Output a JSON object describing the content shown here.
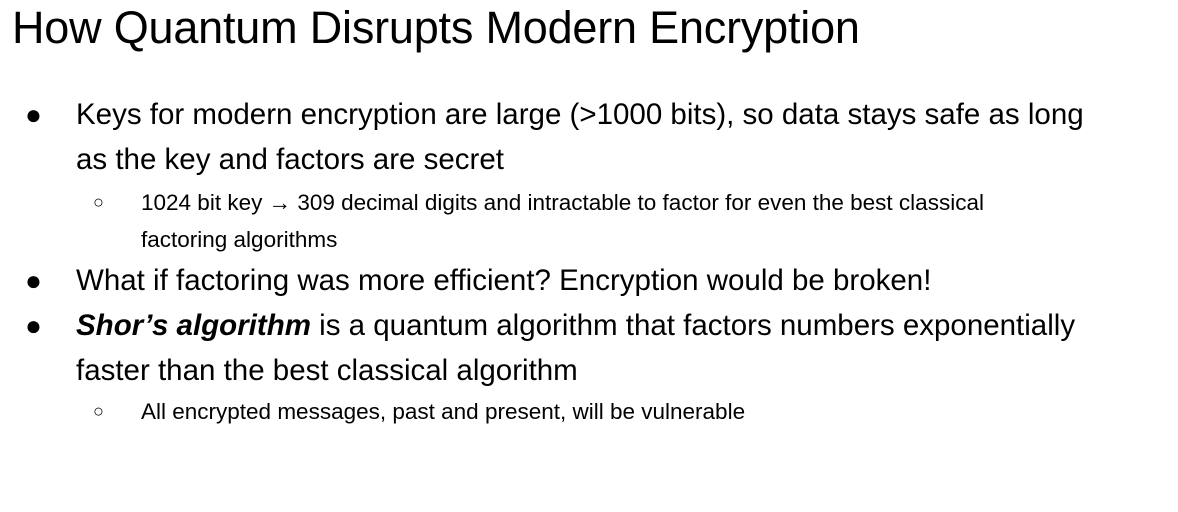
{
  "slide": {
    "title": "How Quantum Disrupts Modern Encryption",
    "bullets": [
      {
        "line1": "Keys for modern encryption are large (>1000 bits), so data stays safe as long",
        "line2": "as the key and factors are secret",
        "subs": [
          {
            "line1": "1024 bit key → 309 decimal digits and intractable to factor for even the best classical",
            "line2": "factoring algorithms"
          }
        ]
      },
      {
        "line1": "What if factoring was more efficient? Encryption would be broken!"
      },
      {
        "emphasis": "Shor’s algorithm",
        "line1_rest": " is a quantum algorithm that factors numbers exponentially",
        "line2": "faster than the best classical algorithm",
        "subs": [
          {
            "line1": "All encrypted messages, past and present, will be vulnerable"
          }
        ]
      }
    ],
    "bullet_glyph": "●",
    "sub_bullet_glyph": "○"
  }
}
